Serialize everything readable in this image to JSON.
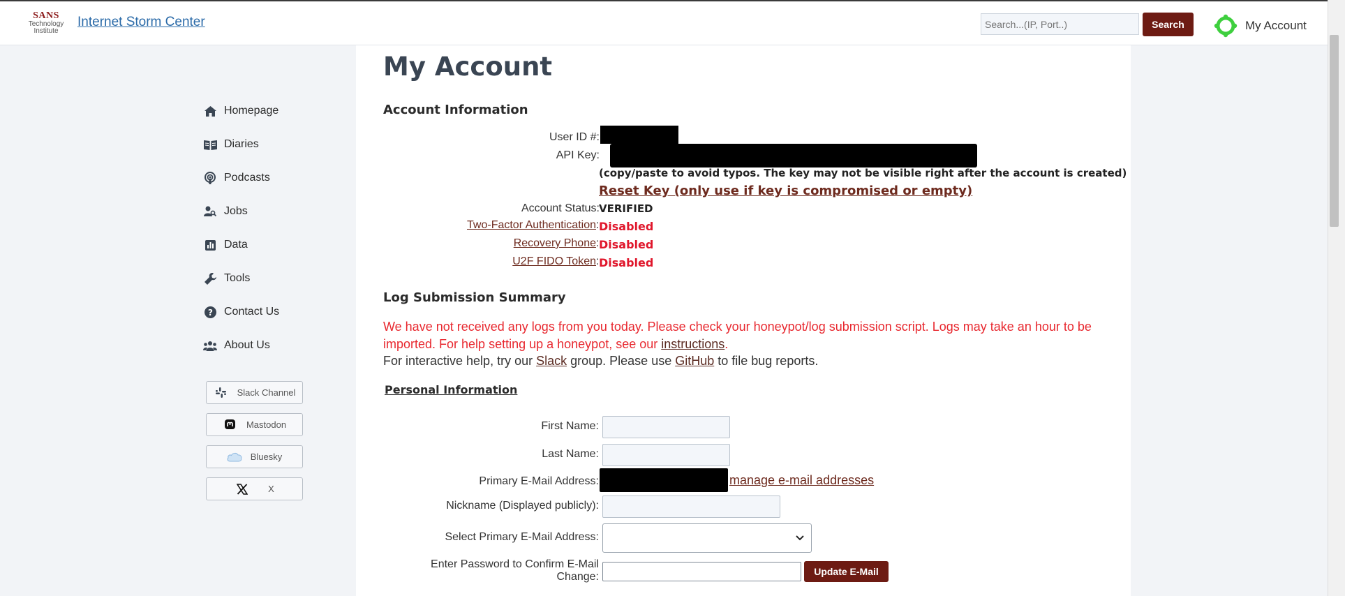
{
  "header": {
    "logo": {
      "line1": "SANS",
      "line2": "Technology",
      "line3": "Institute"
    },
    "site_title": "Internet Storm Center",
    "search_placeholder": "Search...(IP, Port..)",
    "search_button": "Search",
    "account_label": "My Account"
  },
  "sidebar": {
    "items": [
      {
        "label": "Homepage",
        "icon": "home-icon"
      },
      {
        "label": "Diaries",
        "icon": "book-icon"
      },
      {
        "label": "Podcasts",
        "icon": "podcast-icon"
      },
      {
        "label": "Jobs",
        "icon": "user-search-icon"
      },
      {
        "label": "Data",
        "icon": "chart-icon"
      },
      {
        "label": "Tools",
        "icon": "wrench-icon"
      },
      {
        "label": "Contact Us",
        "icon": "question-icon"
      },
      {
        "label": "About Us",
        "icon": "users-icon"
      }
    ],
    "social": [
      {
        "label": "Slack Channel",
        "icon": "slack-icon"
      },
      {
        "label": "Mastodon",
        "icon": "mastodon-icon"
      },
      {
        "label": "Bluesky",
        "icon": "bluesky-icon"
      },
      {
        "label": "X",
        "icon": "x-icon"
      }
    ]
  },
  "main": {
    "page_title": "My Account",
    "account_info": {
      "heading": "Account Information",
      "user_id_label": "User ID #:",
      "api_key_label": "API Key:",
      "api_key_note": "(copy/paste to avoid typos. The key may not be visible right after the account is created)",
      "reset_key": "Reset Key (only use if key is compromised or empty)",
      "status_label": "Account Status:",
      "status_value": "VERIFIED",
      "two_factor_label": "Two-Factor Authentication",
      "two_factor_value": "Disabled",
      "recovery_phone_label": "Recovery Phone",
      "recovery_phone_value": "Disabled",
      "u2f_label": "U2F FIDO Token",
      "u2f_value": "Disabled",
      "colon": ":"
    },
    "log_summary": {
      "heading": "Log Submission Summary",
      "warning_text": "We have not received any logs from you today. Please check your honeypot/log submission script. Logs may take an hour to be imported. For help setting up a honeypot, see our ",
      "warning_link": "instructions",
      "warning_end": ".",
      "help_pre": "For interactive help, try our ",
      "slack_link": "Slack",
      "help_mid": " group. Please use ",
      "github_link": "GitHub",
      "help_post": " to file bug reports."
    },
    "personal": {
      "heading": "Personal Information",
      "first_name_label": "First Name:",
      "first_name_value": "",
      "last_name_label": "Last Name:",
      "last_name_value": "",
      "primary_email_label": "Primary E-Mail Address:",
      "manage_emails_link": "manage e-mail addresses",
      "nickname_label": "Nickname (Displayed publicly):",
      "nickname_value": "",
      "select_email_label": "Select Primary E-Mail Address:",
      "select_email_value": "",
      "password_label_line1": "Enter Password to Confirm E-Mail",
      "password_label_line2": "Change:",
      "password_value": "",
      "update_button": "Update E-Mail"
    }
  },
  "colors": {
    "brand_dark_red": "#6d1b13",
    "link_brown": "#6d2a1e",
    "disabled_red": "#e0162b",
    "warning_red": "#e8282f",
    "site_title_blue": "#2a6aa8",
    "account_icon_green": "#3ecf3e"
  }
}
